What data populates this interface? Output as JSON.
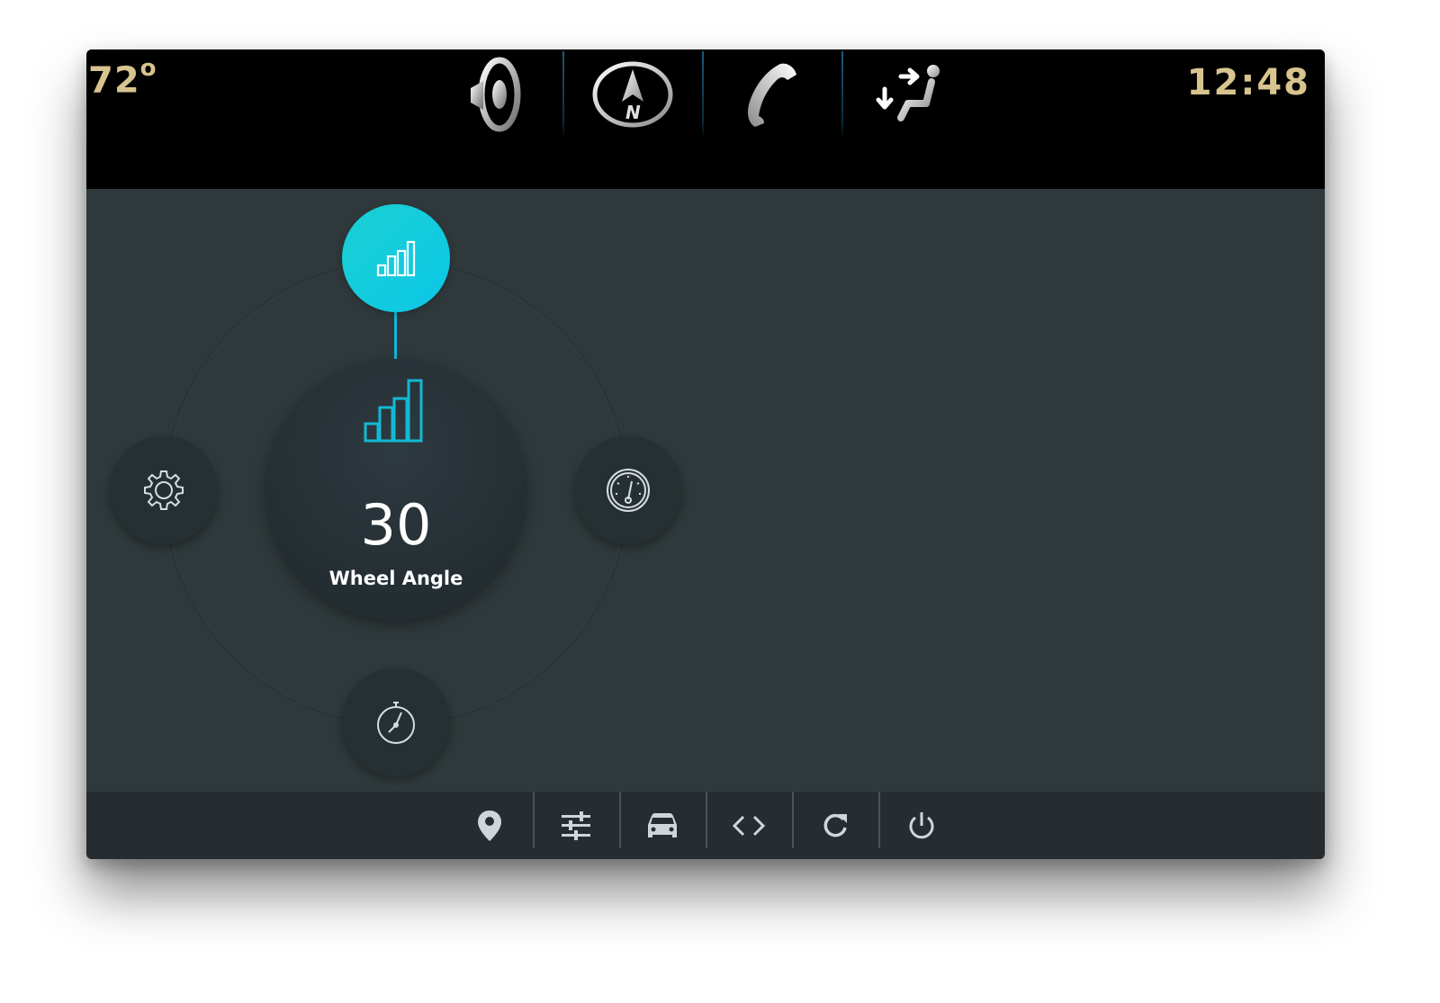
{
  "status": {
    "temperature": "72",
    "temperature_unit": "o",
    "time": "12:48"
  },
  "top_nav": [
    {
      "id": "audio",
      "icon": "speaker-icon"
    },
    {
      "id": "navigation",
      "icon": "compass-north-icon",
      "letter": "N"
    },
    {
      "id": "phone",
      "icon": "phone-icon"
    },
    {
      "id": "climate",
      "icon": "seat-airflow-icon"
    }
  ],
  "dial": {
    "value": "30",
    "label": "Wheel Angle",
    "active_node": "stats",
    "nodes": [
      {
        "id": "stats",
        "icon": "bar-chart-icon",
        "position": "top"
      },
      {
        "id": "settings",
        "icon": "gear-icon",
        "position": "left"
      },
      {
        "id": "gauge",
        "icon": "speedometer-icon",
        "position": "right"
      },
      {
        "id": "timer",
        "icon": "stopwatch-icon",
        "position": "bottom"
      }
    ]
  },
  "bottom_nav": [
    {
      "id": "location",
      "icon": "map-pin-icon"
    },
    {
      "id": "adjust",
      "icon": "sliders-icon"
    },
    {
      "id": "vehicle",
      "icon": "car-icon"
    },
    {
      "id": "code",
      "icon": "code-brackets-icon"
    },
    {
      "id": "refresh",
      "icon": "refresh-icon"
    },
    {
      "id": "power",
      "icon": "power-icon"
    }
  ],
  "colors": {
    "accent": "#10c8e0",
    "status_text": "#d8c48e",
    "background": "#2f393b",
    "top_bar": "#000000",
    "bottom_bar": "#262c30"
  }
}
